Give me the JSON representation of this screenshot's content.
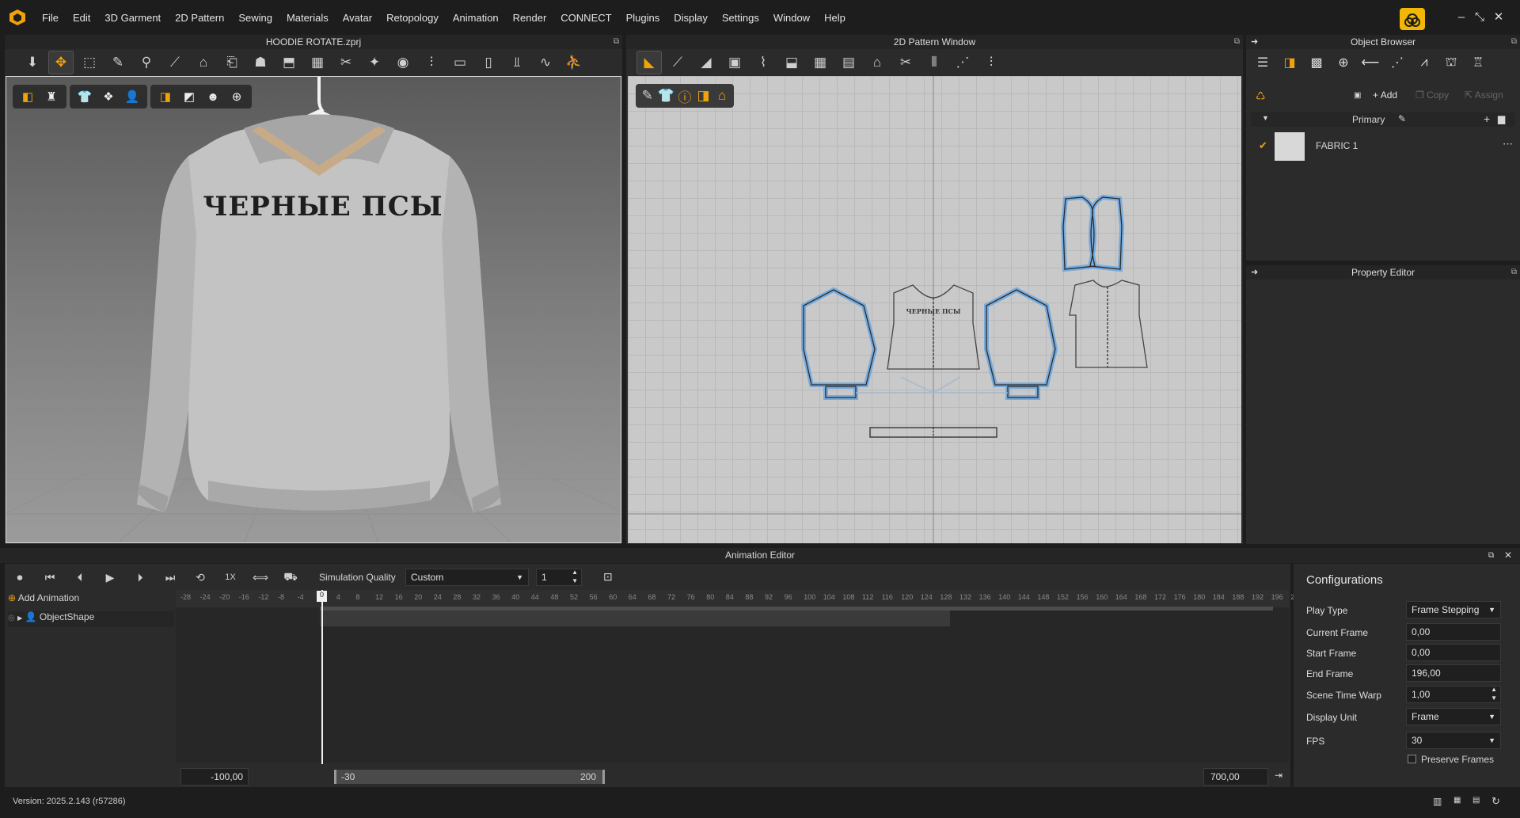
{
  "menubar": {
    "items": [
      "File",
      "Edit",
      "3D Garment",
      "2D Pattern",
      "Sewing",
      "Materials",
      "Avatar",
      "Retopology",
      "Animation",
      "Render",
      "CONNECT",
      "Plugins",
      "Display",
      "Settings",
      "Window",
      "Help"
    ]
  },
  "window_controls": {
    "minimize": "–",
    "restore": "⤡",
    "close": "✕"
  },
  "panels": {
    "viewport3d_title": "HOODIE ROTATE.zprj",
    "pattern_title": "2D Pattern Window",
    "object_browser_title": "Object Browser",
    "property_editor_title": "Property Editor",
    "animation_title": "Animation Editor"
  },
  "garment_print": "ЧЕРНЫЕ ПСЫ",
  "pattern_print": "ЧЕРНЫЕ ПСЫ",
  "object_browser": {
    "add": "Add",
    "copy": "Copy",
    "assign": "Assign",
    "group": "Primary",
    "fabric": "FABRIC 1"
  },
  "animation": {
    "simulation_quality_label": "Simulation Quality",
    "simulation_quality_value": "Custom",
    "quality_number": "1",
    "speed": "1X",
    "add_animation": "Add Animation",
    "track": "ObjectShape",
    "range_start": "-100,00",
    "range_lo": "-30",
    "range_hi": "200",
    "range_end": "700,00",
    "playhead": "0",
    "ticks": [
      "-28",
      "-24",
      "-20",
      "-16",
      "-12",
      "-8",
      "-4",
      "0",
      "4",
      "8",
      "12",
      "16",
      "20",
      "24",
      "28",
      "32",
      "36",
      "40",
      "44",
      "48",
      "52",
      "56",
      "60",
      "64",
      "68",
      "72",
      "76",
      "80",
      "84",
      "88",
      "92",
      "96",
      "100",
      "104",
      "108",
      "112",
      "116",
      "120",
      "124",
      "128",
      "132",
      "136",
      "140",
      "144",
      "148",
      "152",
      "156",
      "160",
      "164",
      "168",
      "172",
      "176",
      "180",
      "184",
      "188",
      "192",
      "196",
      "20"
    ]
  },
  "configurations": {
    "title": "Configurations",
    "play_type_label": "Play Type",
    "play_type": "Frame Stepping",
    "current_frame_label": "Current Frame",
    "current_frame": "0,00",
    "start_frame_label": "Start Frame",
    "start_frame": "0,00",
    "end_frame_label": "End Frame",
    "end_frame": "196,00",
    "time_warp_label": "Scene Time Warp",
    "time_warp": "1,00",
    "display_unit_label": "Display Unit",
    "display_unit": "Frame",
    "fps_label": "FPS",
    "fps": "30",
    "preserve_label": "Preserve Frames"
  },
  "status": {
    "version": "Version: 2025.2.143 (r57286)"
  },
  "colors": {
    "accent": "#f0a20a",
    "pattern_highlight": "#6aa6e0",
    "brand_yellow": "#f2b705"
  }
}
